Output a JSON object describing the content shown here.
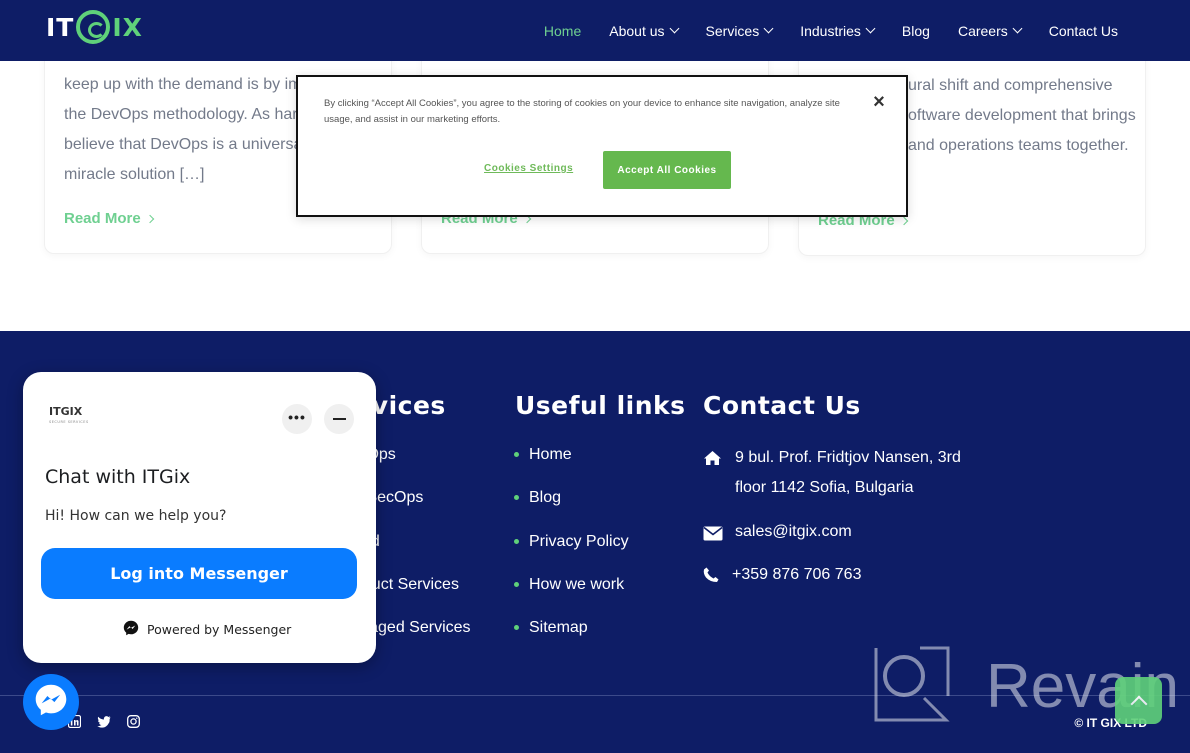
{
  "header": {
    "logo": {
      "it": "IT",
      "ix": "IX"
    },
    "nav": [
      {
        "label": "Home",
        "active": true,
        "dropdown": false
      },
      {
        "label": "About us",
        "active": false,
        "dropdown": true
      },
      {
        "label": "Services",
        "active": false,
        "dropdown": true
      },
      {
        "label": "Industries",
        "active": false,
        "dropdown": true
      },
      {
        "label": "Blog",
        "active": false,
        "dropdown": false
      },
      {
        "label": "Careers",
        "active": false,
        "dropdown": true
      },
      {
        "label": "Contact Us",
        "active": false,
        "dropdown": false
      }
    ]
  },
  "cards": [
    {
      "lines": [
        "keep up with the demand is by imp",
        "the DevOps methodology.  As hard",
        "believe that DevOps is a universal, a",
        "miracle solution […]"
      ],
      "read_more": "Read More"
    },
    {
      "lines": [],
      "read_more": "Read More"
    },
    {
      "lines": [
        "ural shift and comprehensive",
        "oftware development that brings",
        "and operations teams together."
      ],
      "read_more": "Read More"
    }
  ],
  "cookie_banner": {
    "text": "By clicking “Accept All Cookies”, you agree to the storing of cookies on your device to enhance site navigation, analyze site usage, and assist in our marketing efforts.",
    "settings_label": "Cookies Settings",
    "accept_label": "Accept All Cookies",
    "close_icon": "×"
  },
  "footer": {
    "services": {
      "heading": "Services",
      "items": [
        "DevOps",
        "DevSecOps",
        "Cloud",
        "Product Services",
        "Managed Services"
      ]
    },
    "useful_links": {
      "heading": "Useful links",
      "items": [
        "Home",
        "Blog",
        "Privacy Policy",
        "How we work",
        "Sitemap"
      ]
    },
    "contact": {
      "heading": "Contact Us",
      "address_line1": "9 bul. Prof. Fridtjov Nansen, 3rd",
      "address_line2": "floor 1142 Sofia, Bulgaria",
      "email": "sales@itgix.com",
      "phone": "+359 876 706 763"
    },
    "socials": [
      "linkedin-icon",
      "twitter-icon",
      "instagram-icon"
    ],
    "copyright": "© IT GIX LTD"
  },
  "chat_widget": {
    "logo_text": "ITGIX",
    "logo_sub": "SECURE SERVICES",
    "title": "Chat with ITGix",
    "subtitle": "Hi! How can we help you?",
    "login_label": "Log into Messenger",
    "powered_by": "Powered by Messenger"
  },
  "watermark": {
    "text": "Revain"
  },
  "colors": {
    "brand_navy": "#0e1d66",
    "brand_green": "#5fd17a",
    "messenger_blue": "#0a7cff",
    "cookie_green": "#65b84e"
  }
}
